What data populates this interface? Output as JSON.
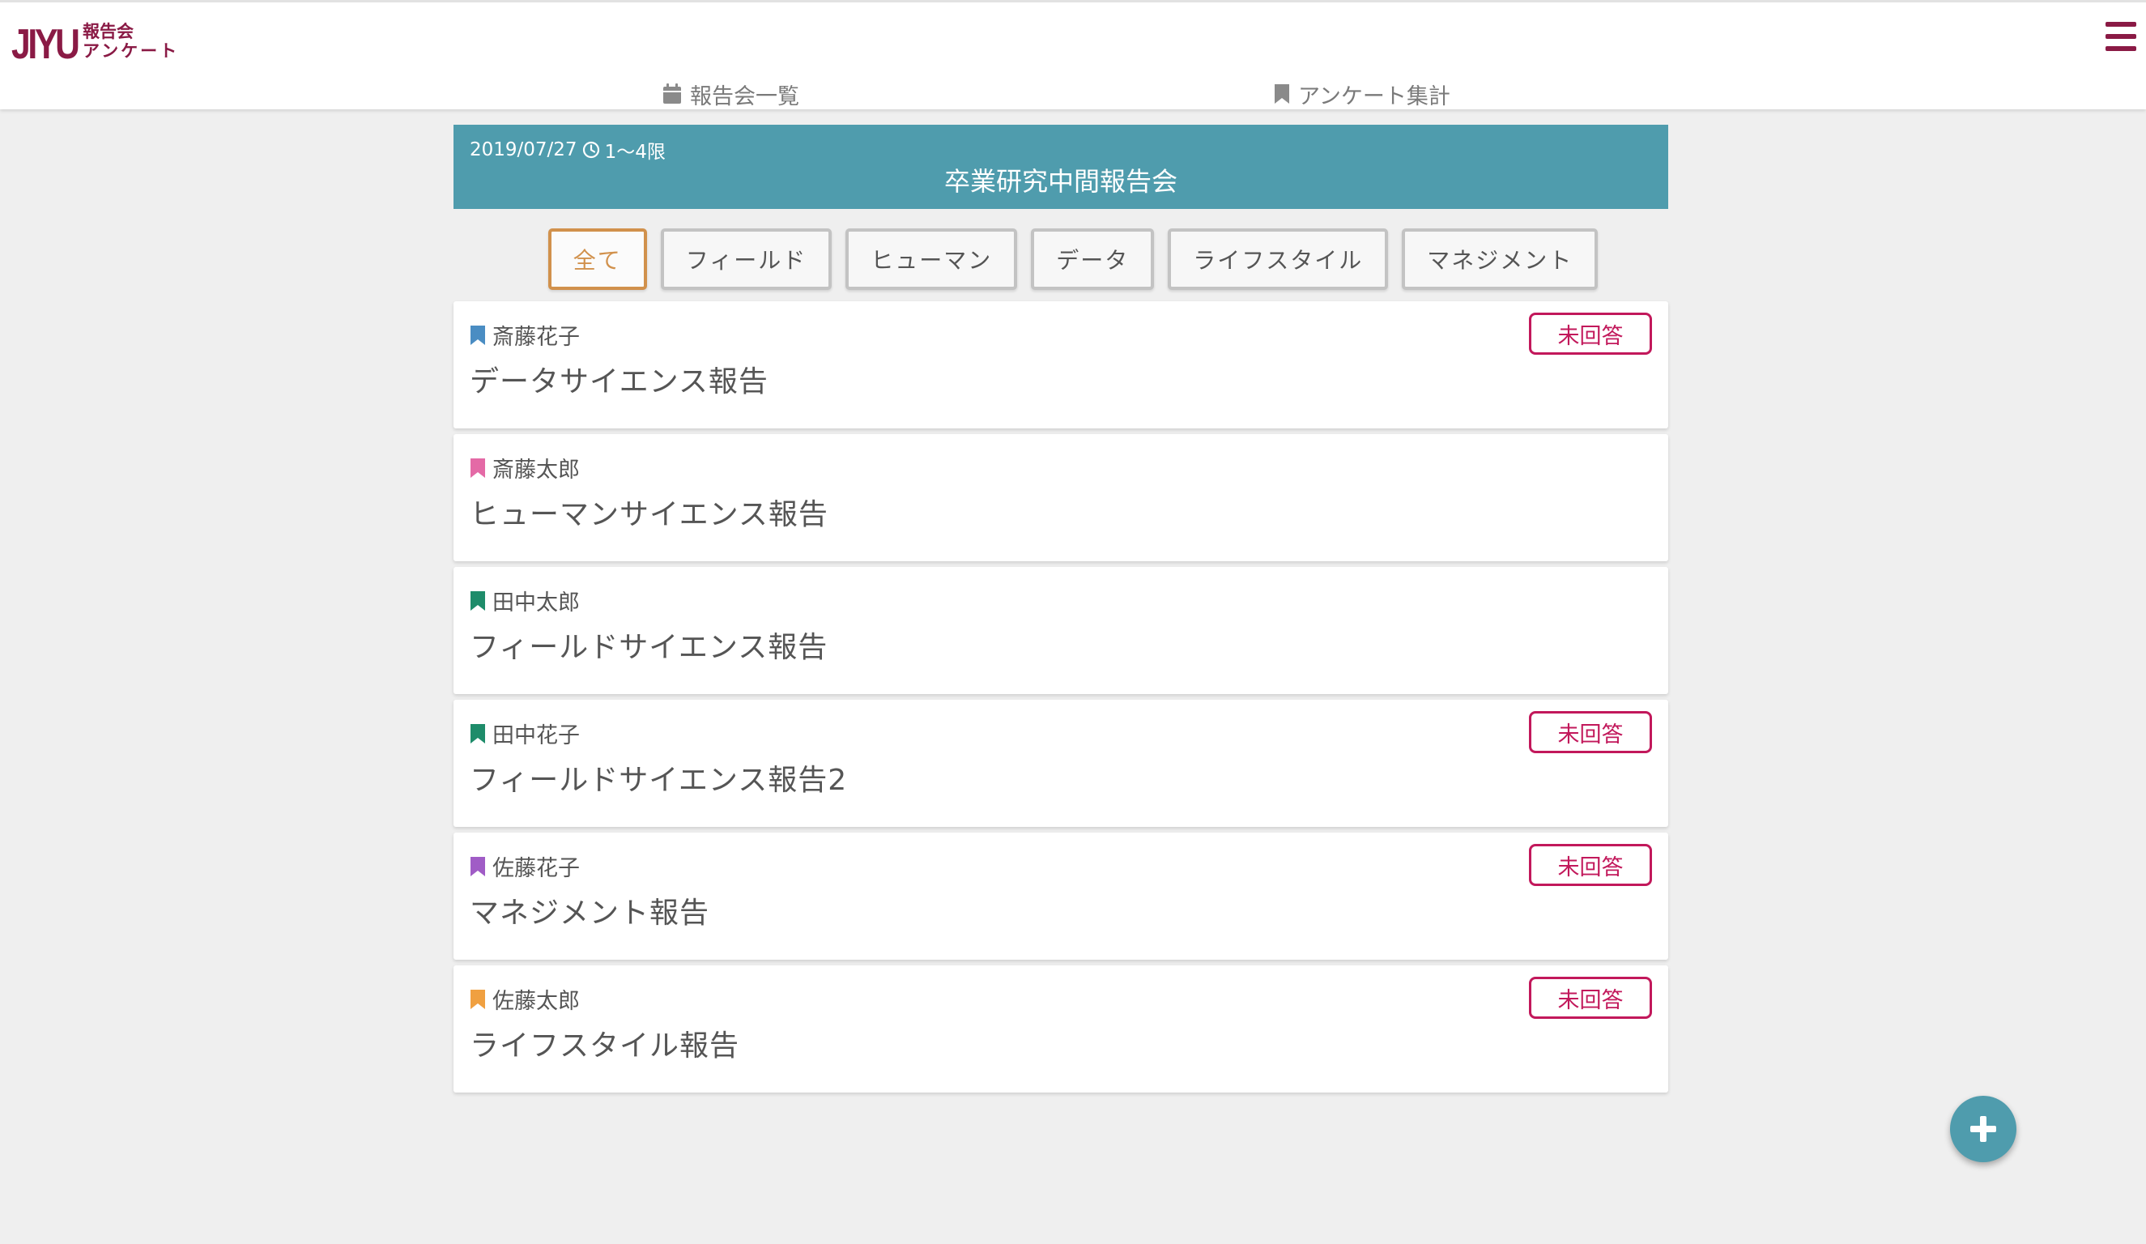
{
  "app": {
    "logo_main": "JIYU",
    "logo_sub1": "報告会",
    "logo_sub2": "アンケート"
  },
  "nav": {
    "reports_label": "報告会一覧",
    "survey_label": "アンケート集計"
  },
  "event": {
    "date": "2019/07/27",
    "period": "1〜4限",
    "title": "卒業研究中間報告会"
  },
  "filters": [
    {
      "label": "全て",
      "active": true
    },
    {
      "label": "フィールド",
      "active": false
    },
    {
      "label": "ヒューマン",
      "active": false
    },
    {
      "label": "データ",
      "active": false
    },
    {
      "label": "ライフスタイル",
      "active": false
    },
    {
      "label": "マネジメント",
      "active": false
    }
  ],
  "reports": [
    {
      "presenter": "斎藤花子",
      "title": "データサイエンス報告",
      "status": "未回答",
      "bookmark_color": "#4a8dc3"
    },
    {
      "presenter": "斎藤太郎",
      "title": "ヒューマンサイエンス報告",
      "status": "",
      "bookmark_color": "#e46aa6"
    },
    {
      "presenter": "田中太郎",
      "title": "フィールドサイエンス報告",
      "status": "",
      "bookmark_color": "#1e8c6a"
    },
    {
      "presenter": "田中花子",
      "title": "フィールドサイエンス報告2",
      "status": "未回答",
      "bookmark_color": "#1e8c6a"
    },
    {
      "presenter": "佐藤花子",
      "title": "マネジメント報告",
      "status": "未回答",
      "bookmark_color": "#a05cc6"
    },
    {
      "presenter": "佐藤太郎",
      "title": "ライフスタイル報告",
      "status": "未回答",
      "bookmark_color": "#f0a040"
    }
  ],
  "colors": {
    "brand": "#8a1a45",
    "banner": "#4f9cad",
    "active_filter": "#d1914c",
    "unanswered": "#c2185b"
  },
  "icons": {
    "calendar": "calendar-icon",
    "bookmark": "bookmark-icon",
    "clock": "clock-icon",
    "menu": "hamburger-menu-icon",
    "add": "plus-icon"
  }
}
